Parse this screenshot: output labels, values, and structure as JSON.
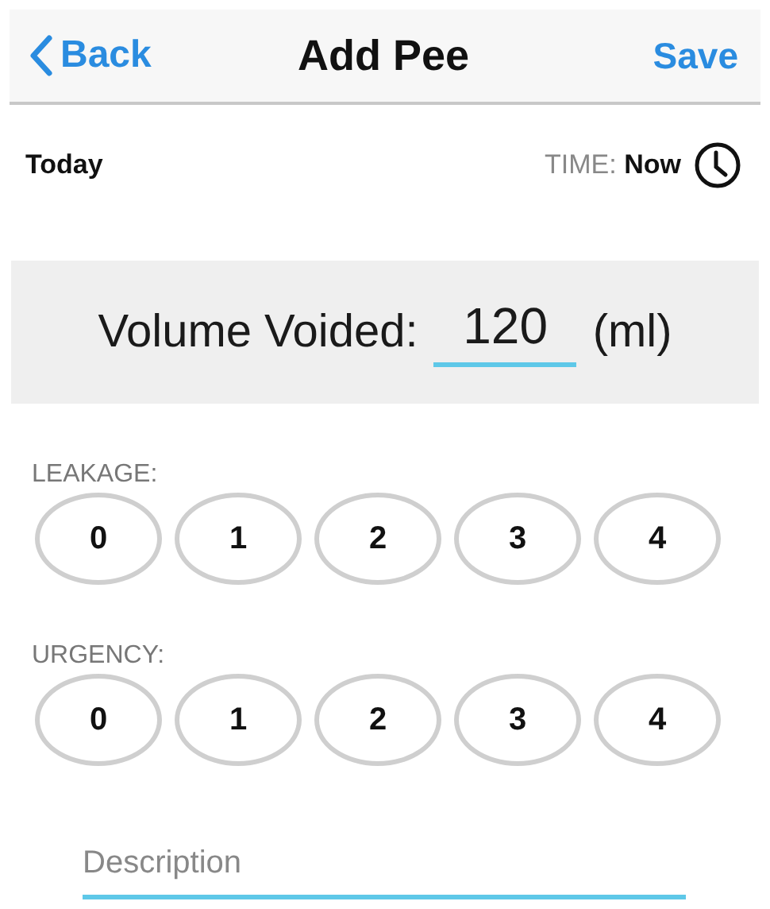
{
  "nav_bar": {
    "back": "Back",
    "title": "Add Pee",
    "save": "Save"
  },
  "date_row": {
    "date": "Today",
    "time_label": "TIME:",
    "time_value": "Now"
  },
  "volume": {
    "label": "Volume Voided:",
    "value": "120",
    "unit": "(ml)"
  },
  "scales": [
    {
      "label": "LEAKAGE:",
      "options": [
        {
          "label": "0",
          "selected": false
        },
        {
          "label": "1",
          "selected": false
        },
        {
          "label": "2",
          "selected": false
        },
        {
          "label": "3",
          "selected": false
        },
        {
          "label": "4",
          "selected": false
        }
      ]
    },
    {
      "label": "URGENCY:",
      "options": [
        {
          "label": "0",
          "selected": false
        },
        {
          "label": "1",
          "selected": false
        },
        {
          "label": "2",
          "selected": false
        },
        {
          "label": "3",
          "selected": false
        },
        {
          "label": "4",
          "selected": false
        }
      ]
    }
  ],
  "description": {
    "placeholder": "Description"
  }
}
